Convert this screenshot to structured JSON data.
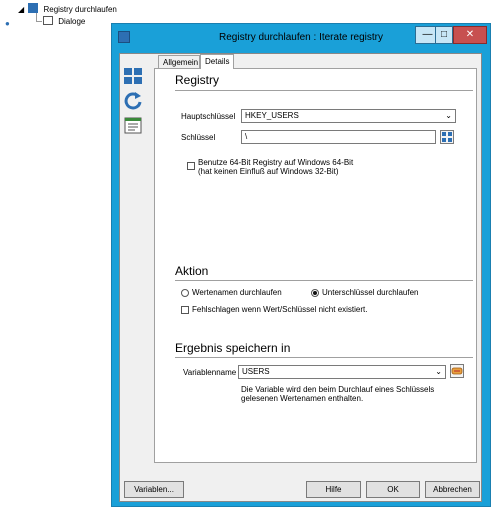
{
  "tree": {
    "root_label": "Registry durchlaufen",
    "child_label": "Dialoge"
  },
  "window": {
    "title": "Registry durchlaufen : Iterate registry",
    "min_glyph": "—",
    "max_glyph": "□",
    "close_glyph": "✕"
  },
  "tabs": [
    {
      "label": "Allgemein"
    },
    {
      "label": "Details"
    }
  ],
  "registry": {
    "heading": "Registry",
    "hauptschluessel_label": "Hauptschlüssel",
    "hauptschluessel_value": "HKEY_USERS",
    "schluessel_label": "Schlüssel",
    "schluessel_value": "\\",
    "checkbox_64bit_line1": "Benutze 64-Bit Registry auf Windows 64-Bit",
    "checkbox_64bit_line2": "(hat keinen Einfluß auf Windows 32-Bit)"
  },
  "aktion": {
    "heading": "Aktion",
    "radio_wertenamen": "Wertenamen durchlaufen",
    "radio_unterschluessel": "Unterschlüssel durchlaufen",
    "checkbox_fehlschlagen": "Fehlschlagen wenn Wert/Schlüssel nicht existiert."
  },
  "ergebnis": {
    "heading": "Ergebnis speichern in",
    "variablenname_label": "Variablenname",
    "variablenname_value": "USERS",
    "description_line1": "Die Variable wird  den beim Durchlauf eines Schlüssels",
    "description_line2": "gelesenen Wertenamen enthalten."
  },
  "buttons": {
    "variablen": "Variablen...",
    "hilfe": "Hilfe",
    "ok": "OK",
    "abbrechen": "Abbrechen"
  },
  "colors": {
    "title_bar": "#1aa0d8",
    "close_button": "#c75050"
  }
}
